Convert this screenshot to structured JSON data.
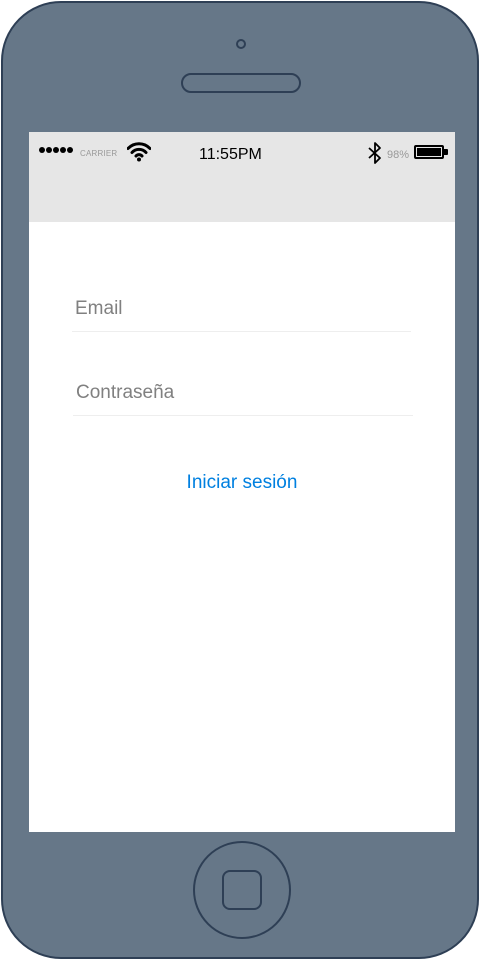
{
  "status_bar": {
    "carrier": "CARRIER",
    "time": "11:55PM",
    "battery_percent": "98%",
    "battery_level": 0.98,
    "signal_bars": 5,
    "icons": [
      "signal-dots-icon",
      "wifi-icon",
      "bluetooth-icon",
      "battery-icon"
    ]
  },
  "login_form": {
    "email_placeholder": "Email",
    "email_value": "",
    "password_placeholder": "Contraseña",
    "password_value": "",
    "submit_label": "Iniciar sesión"
  },
  "colors": {
    "device_body": "#667788",
    "device_outline": "#2e3f55",
    "status_bar_bg": "#e6e6e6",
    "link": "#0080e0",
    "placeholder": "#808080"
  }
}
